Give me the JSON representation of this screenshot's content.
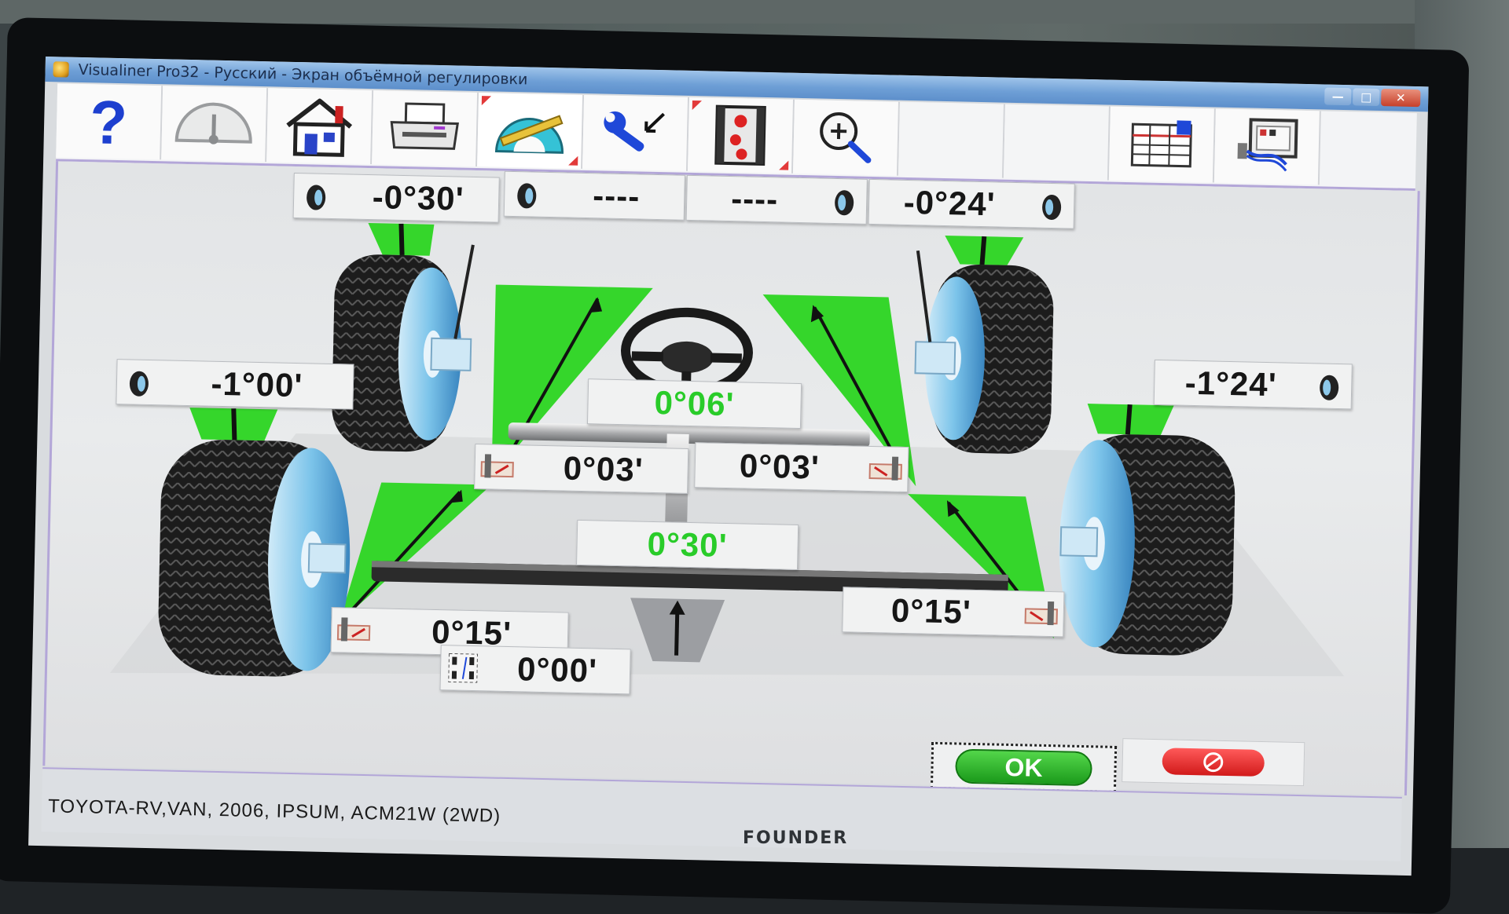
{
  "window": {
    "title": "Visualiner Pro32 - Русский  -  Экран объёмной регулировки",
    "controls": {
      "minimize": "—",
      "maximize": "□",
      "close": "✕"
    }
  },
  "toolbar": {
    "buttons": [
      {
        "icon": "help-icon"
      },
      {
        "icon": "gauge-icon"
      },
      {
        "icon": "home-icon"
      },
      {
        "icon": "printer-icon"
      },
      {
        "icon": "protractor-icon"
      },
      {
        "icon": "wrench-icon"
      },
      {
        "icon": "film-strip-icon"
      },
      {
        "icon": "zoom-icon"
      },
      {
        "icon": ""
      },
      {
        "icon": ""
      },
      {
        "icon": "spreadsheet-icon"
      },
      {
        "icon": "vehicle-data-icon"
      }
    ]
  },
  "alignment": {
    "front_left_camber": "-0°30'",
    "front_center_left": "----",
    "front_center_right": "----",
    "front_right_camber": "-0°24'",
    "rear_left_camber": "-1°00'",
    "rear_right_camber": "-1°24'",
    "front_total_toe": "0°06'",
    "front_left_toe": "0°03'",
    "front_right_toe": "0°03'",
    "rear_total_toe": "0°30'",
    "rear_left_toe": "0°15'",
    "rear_right_toe": "0°15'",
    "thrust_angle": "0°00'"
  },
  "actions": {
    "ok_label": "OK",
    "cancel_icon": "no-entry-icon"
  },
  "status": {
    "vehicle": "TOYOTA-RV,VAN, 2006, IPSUM, ACM21W (2WD)"
  },
  "monitor": {
    "brand": "FOUNDER"
  },
  "colors": {
    "indicator_green": "#35d62b",
    "value_green": "#29cc29",
    "accent_purple": "#b3a6d8"
  }
}
